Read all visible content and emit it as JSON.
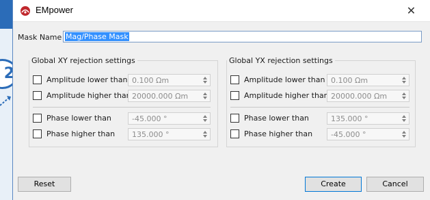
{
  "window": {
    "title": "EMpower",
    "close_glyph": "✕"
  },
  "background": {
    "step_badge": "2"
  },
  "mask": {
    "label": "Mask Name",
    "value": "Mag/Phase Mask"
  },
  "groups": [
    {
      "title": "Global XY rejection settings",
      "rows": [
        {
          "label": "Amplitude lower than",
          "value": "0.100 Ωm",
          "checked": false
        },
        {
          "label": "Amplitude higher than",
          "value": "20000.000 Ωm",
          "checked": false
        },
        {
          "label": "Phase lower than",
          "value": "-45.000 °",
          "checked": false
        },
        {
          "label": "Phase higher than",
          "value": "135.000 °",
          "checked": false
        }
      ]
    },
    {
      "title": "Global YX rejection settings",
      "rows": [
        {
          "label": "Amplitude lower than",
          "value": "0.100 Ωm",
          "checked": false
        },
        {
          "label": "Amplitude higher than",
          "value": "20000.000 Ωm",
          "checked": false
        },
        {
          "label": "Phase lower than",
          "value": "135.000 °",
          "checked": false
        },
        {
          "label": "Phase higher than",
          "value": "-45.000 °",
          "checked": false
        }
      ]
    }
  ],
  "buttons": {
    "reset": "Reset",
    "create": "Create",
    "cancel": "Cancel"
  },
  "icons": {
    "app": "empower-app-icon",
    "close": "close-icon",
    "spin": "spin-arrows-icon"
  },
  "colors": {
    "selection": "#3390ff",
    "accent": "#0078d7",
    "host_blue": "#2b6cb8"
  }
}
